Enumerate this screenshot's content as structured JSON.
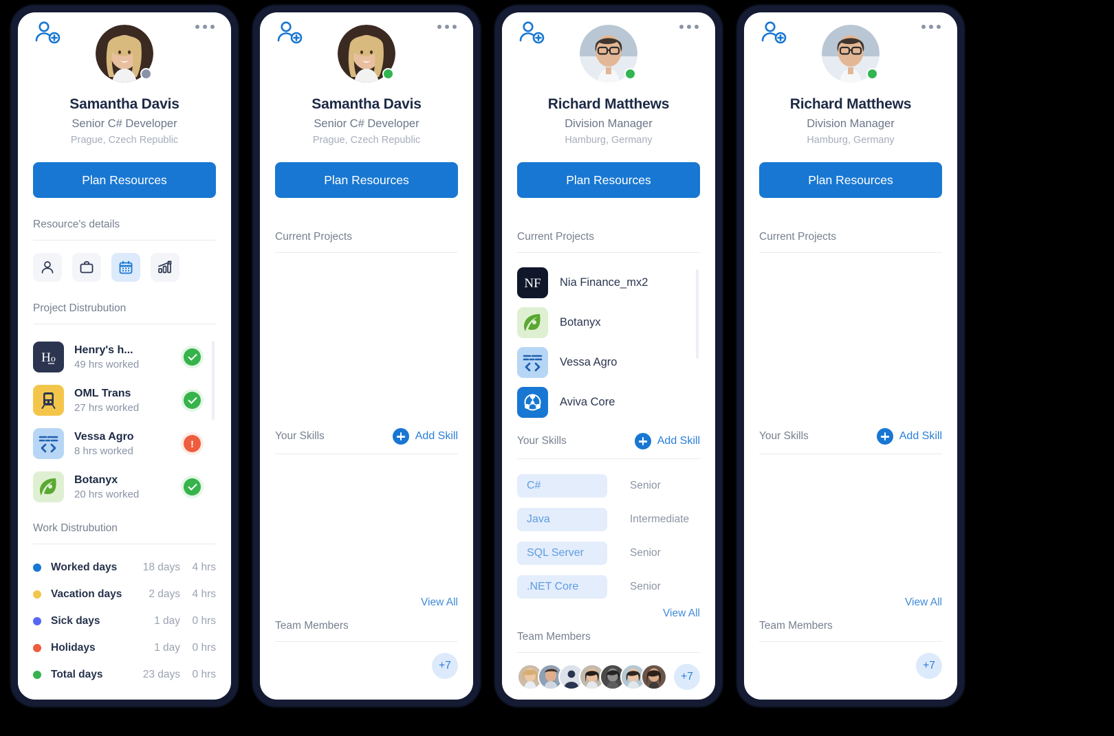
{
  "brand": {
    "accent": "#1877d2",
    "link": "#2a7fd8",
    "frame": "#141b33",
    "green": "#36b34b",
    "yellow": "#f3c64b",
    "red": "#ee5d3d",
    "indigo": "#5667f5",
    "blue_dot": "#1877d2"
  },
  "common": {
    "plan_button": "Plan Resources",
    "add_user_icon": "add-user-icon",
    "more_icon": "more-options-icon",
    "add_skill_label": "Add Skill",
    "view_all": "View All",
    "team_more_count": "+7",
    "headings": {
      "resource_details": "Resource's details",
      "project_distribution": "Project Distrubution",
      "work_distribution": "Work Distrubution",
      "current_projects": "Current Projects",
      "your_skills": "Your Skills",
      "team_members": "Team Members"
    }
  },
  "people": {
    "samantha": {
      "name": "Samantha Davis",
      "role": "Senior C# Developer",
      "location": "Prague, Czech Republic"
    },
    "richard": {
      "name": "Richard Matthews",
      "role": "Division Manager",
      "location": "Hamburg, Germany"
    }
  },
  "panels": [
    {
      "id": "panel-1",
      "person": "samantha",
      "status": "offline",
      "sections": [
        "details-tabs",
        "project-distribution",
        "work-distribution"
      ]
    },
    {
      "id": "panel-2",
      "person": "samantha",
      "status": "online",
      "sections": [
        "current-projects-empty",
        "skills-empty",
        "team-empty"
      ]
    },
    {
      "id": "panel-3",
      "person": "richard",
      "status": "online",
      "sections": [
        "current-projects",
        "skills",
        "team"
      ]
    },
    {
      "id": "panel-4",
      "person": "richard",
      "status": "online",
      "sections": [
        "current-projects-empty",
        "skills-empty",
        "team-empty"
      ]
    }
  ],
  "detail_tabs": [
    {
      "icon": "person-icon",
      "label": "Personal",
      "active": false
    },
    {
      "icon": "briefcase-icon",
      "label": "Work",
      "active": false
    },
    {
      "icon": "calendar-icon",
      "label": "Calendar",
      "active": true
    },
    {
      "icon": "chart-icon",
      "label": "Analytics",
      "active": false
    }
  ],
  "project_distribution": [
    {
      "name": "Henry's h...",
      "hours": "49 hrs worked",
      "icon": "henrys-logo-icon",
      "status": "ok"
    },
    {
      "name": "OML Trans",
      "hours": "27 hrs worked",
      "icon": "train-icon",
      "status": "ok"
    },
    {
      "name": "Vessa Agro",
      "hours": "8 hrs worked",
      "icon": "code-window-icon",
      "status": "warn"
    },
    {
      "name": "Botanyx",
      "hours": "20 hrs worked",
      "icon": "leaf-icon",
      "status": "ok"
    }
  ],
  "current_projects": [
    {
      "name": "Nia Finance_mx2",
      "icon": "nf-logo-icon"
    },
    {
      "name": "Botanyx",
      "icon": "leaf-icon"
    },
    {
      "name": "Vessa Agro",
      "icon": "code-window-icon"
    },
    {
      "name": "Aviva Core",
      "icon": "network-icon"
    }
  ],
  "work_distribution": [
    {
      "label": "Worked days",
      "days": "18 days",
      "hrs": "4 hrs",
      "color": "#1877d2",
      "total": false
    },
    {
      "label": "Vacation days",
      "days": "2 days",
      "hrs": "4 hrs",
      "color": "#f3c64b",
      "total": false
    },
    {
      "label": "Sick days",
      "days": "1 day",
      "hrs": "0 hrs",
      "color": "#5667f5",
      "total": false
    },
    {
      "label": "Holidays",
      "days": "1 day",
      "hrs": "0 hrs",
      "color": "#ee5d3d",
      "total": false
    },
    {
      "label": "Total days",
      "days": "23 days",
      "hrs": "0 hrs",
      "color": "#36b34b",
      "total": true
    }
  ],
  "skills": [
    {
      "name": "C#",
      "level": "Senior"
    },
    {
      "name": "Java",
      "level": "Intermediate"
    },
    {
      "name": "SQL Server",
      "level": "Senior"
    },
    {
      "name": ".NET Core",
      "level": "Senior"
    }
  ],
  "team_members": [
    {
      "name": "member-1",
      "tone": "#c8a98b"
    },
    {
      "name": "member-2",
      "tone": "#9aa5b8"
    },
    {
      "name": "member-3",
      "tone": "#cfd6e1"
    },
    {
      "name": "member-4",
      "tone": "#8f8277"
    },
    {
      "name": "member-5",
      "tone": "#5b5b5b"
    },
    {
      "name": "member-6",
      "tone": "#b9c8cf"
    },
    {
      "name": "member-7",
      "tone": "#6b5548"
    }
  ]
}
